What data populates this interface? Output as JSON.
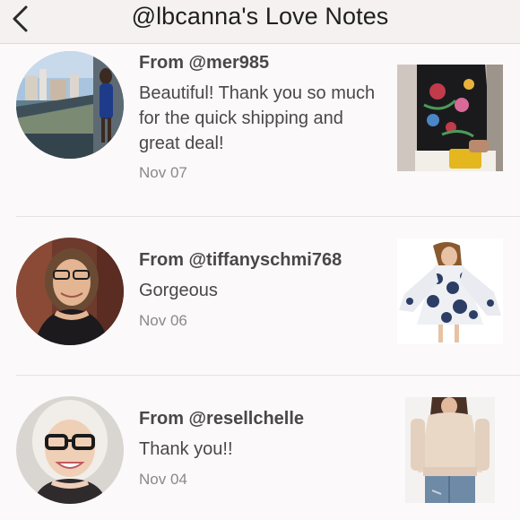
{
  "header": {
    "title": "@lbcanna's Love Notes"
  },
  "notes": [
    {
      "from": "From @mer985",
      "message": "Beautiful! Thank you so much for the quick shipping and great deal!",
      "date": "Nov 07"
    },
    {
      "from": "From @tiffanyschmi768",
      "message": "Gorgeous",
      "date": "Nov 06"
    },
    {
      "from": "From @resellchelle",
      "message": "Thank you!!",
      "date": "Nov 04"
    }
  ]
}
